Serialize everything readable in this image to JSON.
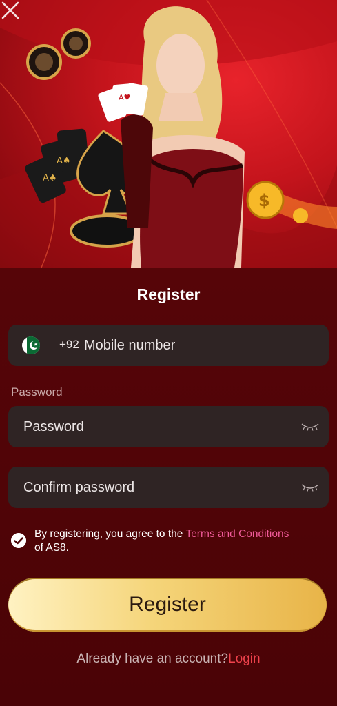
{
  "modal": {
    "title": "Register",
    "close_icon": "close-icon"
  },
  "phone": {
    "country_flag": "pakistan-flag-icon",
    "country_code": "+92",
    "placeholder": "Mobile number"
  },
  "password": {
    "label": "Password",
    "placeholder": "Password",
    "toggle_icon": "eye-closed-icon"
  },
  "confirm_password": {
    "placeholder": "Confirm password",
    "toggle_icon": "eye-closed-icon"
  },
  "agreement": {
    "checked": true,
    "prefix": "By registering, you agree to the ",
    "link": "Terms and Conditions",
    "suffix": "of AS8."
  },
  "register_button": "Register",
  "footer": {
    "question": "Already have an account?",
    "login": "Login"
  },
  "colors": {
    "background": "#4a0306",
    "field": "#2f2424",
    "link": "#f15b9a",
    "login": "#f0424c",
    "button_gold": "#f5d57a"
  }
}
